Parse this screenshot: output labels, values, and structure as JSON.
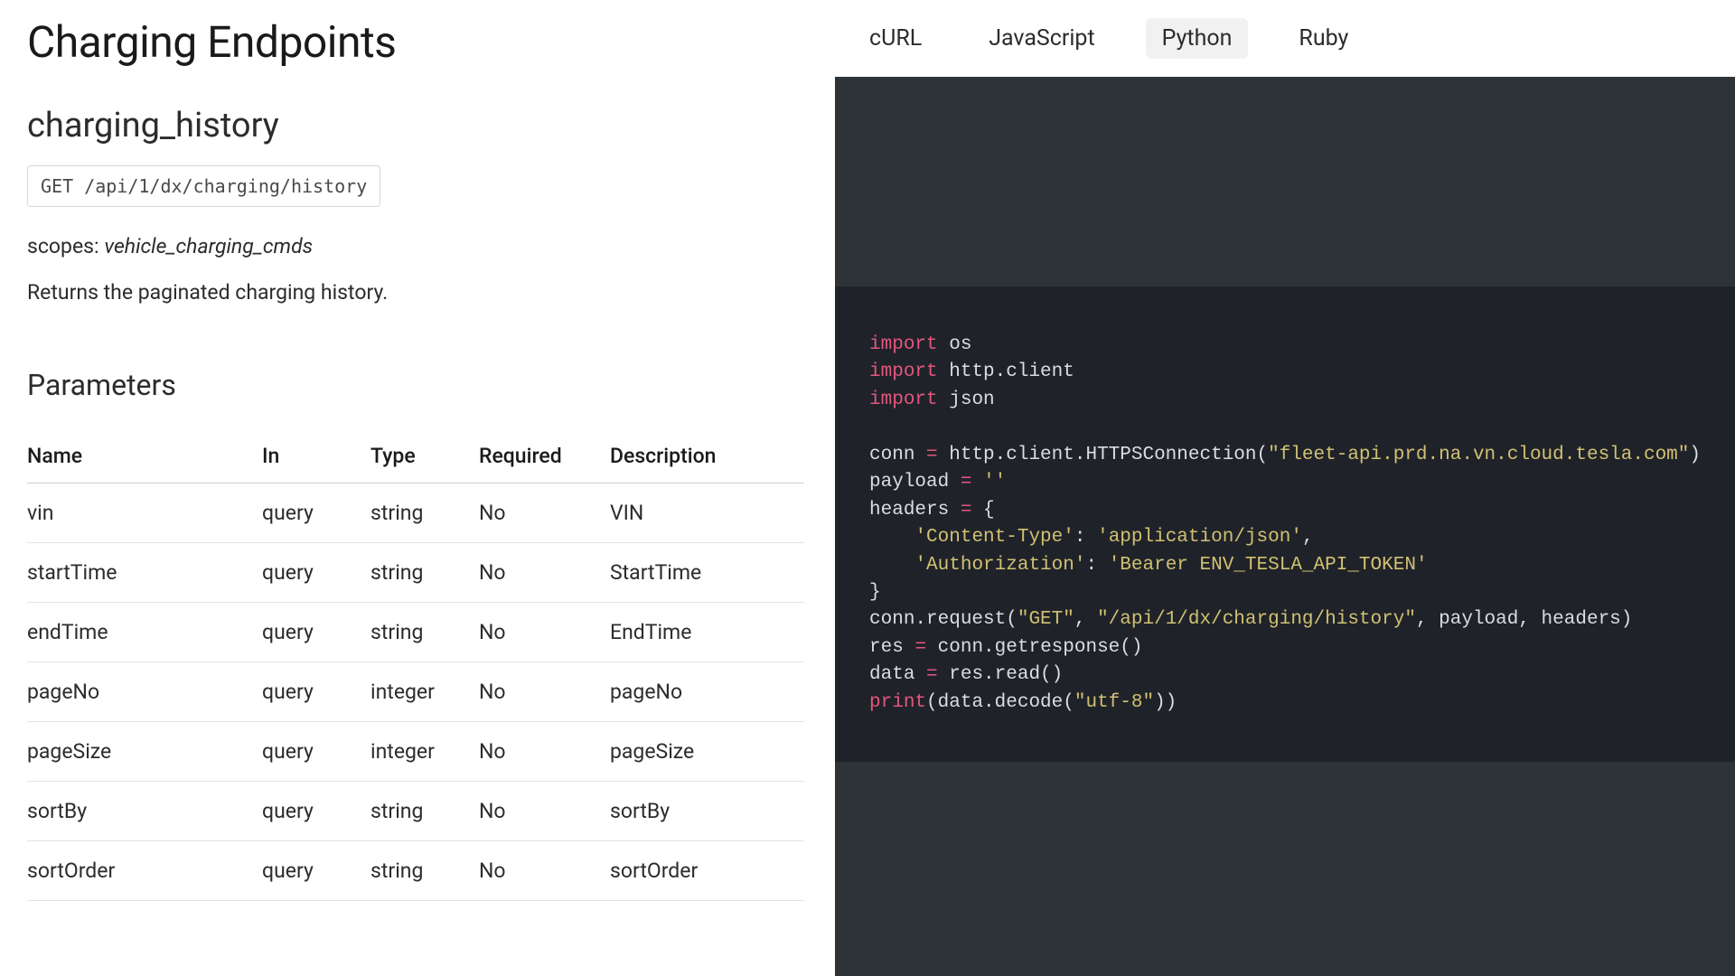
{
  "page_title": "Charging Endpoints",
  "tabs": [
    "cURL",
    "JavaScript",
    "Python",
    "Ruby"
  ],
  "active_tab": "Python",
  "endpoint": {
    "name": "charging_history",
    "path": "GET /api/1/dx/charging/history",
    "scopes_label": "scopes:",
    "scopes_value": "vehicle_charging_cmds",
    "description": "Returns the paginated charging history."
  },
  "params_title": "Parameters",
  "params_headers": [
    "Name",
    "In",
    "Type",
    "Required",
    "Description"
  ],
  "params": [
    {
      "name": "vin",
      "in": "query",
      "type": "string",
      "required": "No",
      "desc": "VIN"
    },
    {
      "name": "startTime",
      "in": "query",
      "type": "string",
      "required": "No",
      "desc": "StartTime"
    },
    {
      "name": "endTime",
      "in": "query",
      "type": "string",
      "required": "No",
      "desc": "EndTime"
    },
    {
      "name": "pageNo",
      "in": "query",
      "type": "integer",
      "required": "No",
      "desc": "pageNo"
    },
    {
      "name": "pageSize",
      "in": "query",
      "type": "integer",
      "required": "No",
      "desc": "pageSize"
    },
    {
      "name": "sortBy",
      "in": "query",
      "type": "string",
      "required": "No",
      "desc": "sortBy"
    },
    {
      "name": "sortOrder",
      "in": "query",
      "type": "string",
      "required": "No",
      "desc": "sortOrder"
    }
  ],
  "code": {
    "lines": [
      [
        {
          "t": "import",
          "c": "kw"
        },
        {
          "t": " os"
        }
      ],
      [
        {
          "t": "import",
          "c": "kw"
        },
        {
          "t": " http.client"
        }
      ],
      [
        {
          "t": "import",
          "c": "kw"
        },
        {
          "t": " json"
        }
      ],
      [],
      [
        {
          "t": "conn "
        },
        {
          "t": "=",
          "c": "op"
        },
        {
          "t": " http.client.HTTPSConnection("
        },
        {
          "t": "\"fleet-api.prd.na.vn.cloud.tesla.com\"",
          "c": "str"
        },
        {
          "t": ")"
        }
      ],
      [
        {
          "t": "payload "
        },
        {
          "t": "=",
          "c": "op"
        },
        {
          "t": " "
        },
        {
          "t": "''",
          "c": "str"
        }
      ],
      [
        {
          "t": "headers "
        },
        {
          "t": "=",
          "c": "op"
        },
        {
          "t": " {"
        }
      ],
      [
        {
          "t": "    "
        },
        {
          "t": "'Content-Type'",
          "c": "str"
        },
        {
          "t": ": "
        },
        {
          "t": "'application/json'",
          "c": "str"
        },
        {
          "t": ","
        }
      ],
      [
        {
          "t": "    "
        },
        {
          "t": "'Authorization'",
          "c": "str"
        },
        {
          "t": ": "
        },
        {
          "t": "'Bearer ENV_TESLA_API_TOKEN'",
          "c": "str"
        }
      ],
      [
        {
          "t": "}"
        }
      ],
      [
        {
          "t": "conn.request("
        },
        {
          "t": "\"GET\"",
          "c": "str"
        },
        {
          "t": ", "
        },
        {
          "t": "\"/api/1/dx/charging/history\"",
          "c": "str"
        },
        {
          "t": ", payload, headers)"
        }
      ],
      [
        {
          "t": "res "
        },
        {
          "t": "=",
          "c": "op"
        },
        {
          "t": " conn.getresponse()"
        }
      ],
      [
        {
          "t": "data "
        },
        {
          "t": "=",
          "c": "op"
        },
        {
          "t": " res.read()"
        }
      ],
      [
        {
          "t": "print",
          "c": "fn"
        },
        {
          "t": "(data.decode("
        },
        {
          "t": "\"utf-8\"",
          "c": "str"
        },
        {
          "t": "))"
        }
      ]
    ]
  }
}
